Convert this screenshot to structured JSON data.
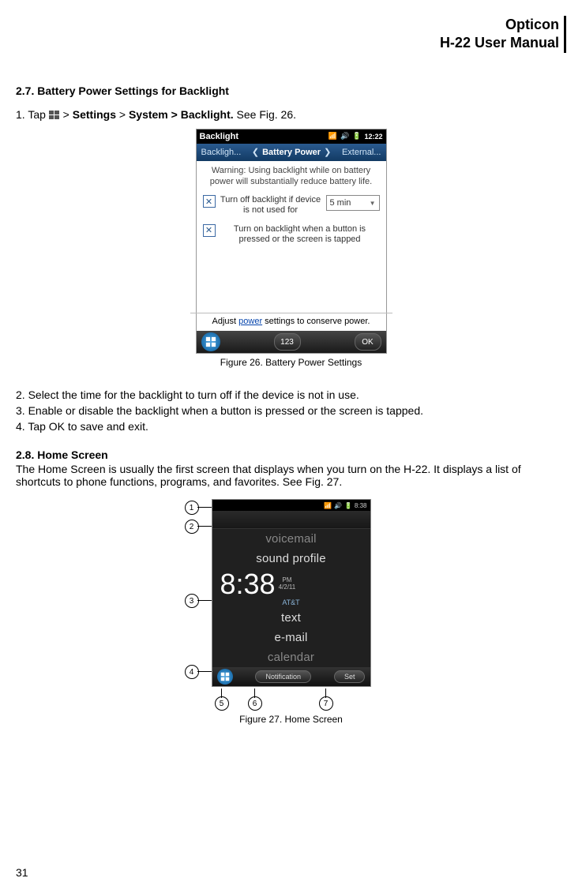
{
  "header": {
    "brand": "Opticon",
    "title": "H-22 User Manual"
  },
  "section27": {
    "num_title": "2.7.   Battery Power Settings for Backlight",
    "step1_prefix": "1.    Tap ",
    "step1_mid1": "  > ",
    "step1_b1": "Settings",
    "step1_mid2": " > ",
    "step1_b2": "System > ",
    "step1_b3": "Backlight.",
    "step1_suffix": "  See Fig. 26."
  },
  "fig26": {
    "title": "Backlight",
    "time": "12:22",
    "tab_left": "Backligh...",
    "tab_center": "Battery Power",
    "tab_right": "External...",
    "warning": "Warning: Using backlight while on battery power will substantially reduce battery life.",
    "check1": "Turn off backlight if device is not used for",
    "dropdown": "5 min",
    "check2": "Turn on backlight when a button is pressed or the screen is tapped",
    "footer_pre": "Adjust ",
    "footer_link": "power",
    "footer_post": " settings to conserve power.",
    "kbtn": "123",
    "ok": "OK",
    "caption": "Figure 26. Battery Power Settings"
  },
  "steps_after": {
    "s2": "2.    Select the time for the backlight to turn off if the device is not in use.",
    "s3": "3.    Enable or disable the backlight when a button is pressed or the screen is tapped.",
    "s4": "4.    Tap OK to save and exit."
  },
  "section28": {
    "num_title": "2.8.   Home Screen",
    "para": "The Home Screen is usually the first screen that displays when you turn on the H-22. It displays a list of shortcuts to phone functions, programs, and favorites. See Fig. 27."
  },
  "fig27": {
    "status_time": "8:38",
    "items": {
      "voicemail": "voicemail",
      "sound": "sound profile",
      "text": "text",
      "email": "e-mail",
      "calendar": "calendar"
    },
    "clock": "8:38",
    "pm": "PM",
    "date": "4/2/11",
    "carrier": "AT&T",
    "btn_left": "Notification",
    "btn_right": "Set",
    "callouts": {
      "c1": "1",
      "c2": "2",
      "c3": "3",
      "c4": "4",
      "c5": "5",
      "c6": "6",
      "c7": "7"
    },
    "caption": "Figure 27. Home Screen"
  },
  "page_number": "31"
}
